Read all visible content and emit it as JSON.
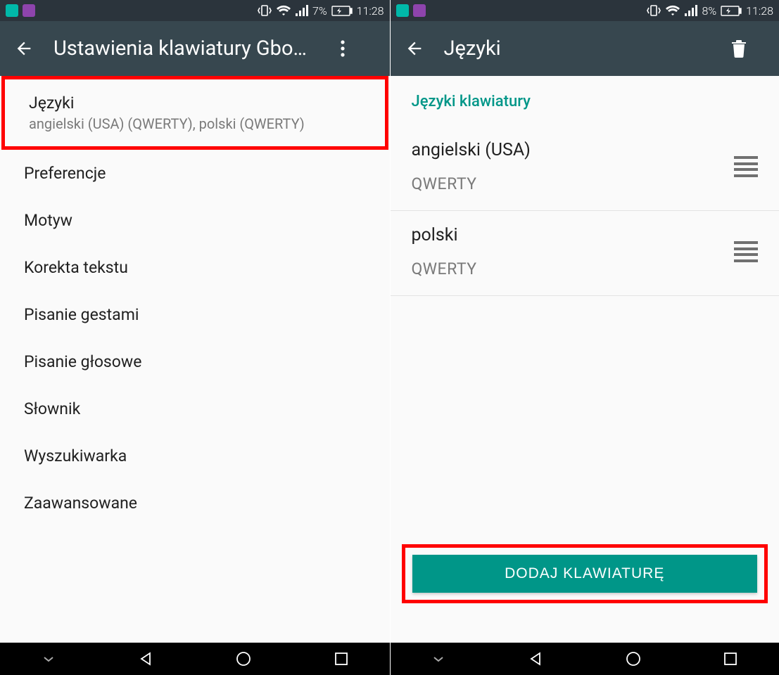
{
  "left": {
    "statusbar": {
      "battery": "7%",
      "time": "11:28"
    },
    "appbar": {
      "title": "Ustawienia klawiatury Gbo…"
    },
    "items": [
      {
        "title": "Języki",
        "sub": "angielski (USA) (QWERTY), polski (QWERTY)"
      },
      {
        "title": "Preferencje"
      },
      {
        "title": "Motyw"
      },
      {
        "title": "Korekta tekstu"
      },
      {
        "title": "Pisanie gestami"
      },
      {
        "title": "Pisanie głosowe"
      },
      {
        "title": "Słownik"
      },
      {
        "title": "Wyszukiwarka"
      },
      {
        "title": "Zaawansowane"
      }
    ]
  },
  "right": {
    "statusbar": {
      "battery": "8%",
      "time": "11:28"
    },
    "appbar": {
      "title": "Języki"
    },
    "section_header": "Języki klawiatury",
    "langs": [
      {
        "name": "angielski (USA)",
        "layout": "QWERTY"
      },
      {
        "name": "polski",
        "layout": "QWERTY"
      }
    ],
    "add_button": "DODAJ KLAWIATURĘ"
  }
}
